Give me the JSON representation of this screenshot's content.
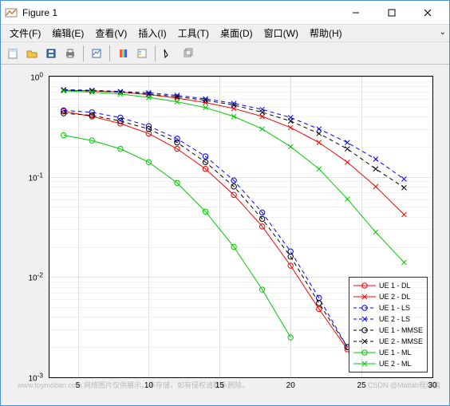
{
  "window": {
    "title": "Figure 1"
  },
  "menus": [
    "文件(F)",
    "编辑(E)",
    "查看(V)",
    "插入(I)",
    "工具(T)",
    "桌面(D)",
    "窗口(W)",
    "帮助(H)"
  ],
  "toolbar_icons": [
    "new-figure",
    "open",
    "save",
    "print",
    "sep",
    "zoom-in",
    "sep",
    "colorbar",
    "legend",
    "sep",
    "arrow",
    "rotate3d"
  ],
  "chart_data": {
    "type": "line",
    "xlabel": "",
    "ylabel": "",
    "xlim": [
      3,
      30
    ],
    "ylim": [
      0.001,
      1
    ],
    "yscale": "log",
    "xticks": [
      5,
      10,
      15,
      20,
      25,
      30
    ],
    "yticks_exp": [
      -3,
      -2,
      -1,
      0
    ],
    "x": [
      4,
      6,
      8,
      10,
      12,
      14,
      16,
      18,
      20,
      22,
      24,
      26,
      28
    ],
    "series": [
      {
        "name": "UE 1 - DL",
        "color": "#ff0000",
        "marker": "o",
        "dash": false,
        "values": [
          0.45,
          0.4,
          0.34,
          0.27,
          0.19,
          0.12,
          0.066,
          0.032,
          0.013,
          0.0048,
          0.0019,
          null,
          null
        ]
      },
      {
        "name": "UE 2 - DL",
        "color": "#ff0000",
        "marker": "x",
        "dash": false,
        "values": [
          0.73,
          0.72,
          0.7,
          0.66,
          0.61,
          0.55,
          0.48,
          0.4,
          0.31,
          0.22,
          0.14,
          0.08,
          0.042
        ]
      },
      {
        "name": "UE 1 - LS",
        "color": "#0000ff",
        "marker": "o",
        "dash": true,
        "values": [
          0.46,
          0.44,
          0.39,
          0.32,
          0.24,
          0.16,
          0.092,
          0.044,
          0.018,
          0.0062,
          0.002,
          0.00099,
          null
        ]
      },
      {
        "name": "UE 2 - LS",
        "color": "#0000ff",
        "marker": "x",
        "dash": true,
        "values": [
          0.74,
          0.73,
          0.71,
          0.69,
          0.65,
          0.6,
          0.54,
          0.47,
          0.39,
          0.3,
          0.22,
          0.15,
          0.095
        ]
      },
      {
        "name": "UE 1 - MMSE",
        "color": "#000000",
        "marker": "o",
        "dash": true,
        "values": [
          0.43,
          0.41,
          0.36,
          0.3,
          0.22,
          0.14,
          0.08,
          0.038,
          0.016,
          0.0055,
          0.002,
          null,
          null
        ]
      },
      {
        "name": "UE 2 - MMSE",
        "color": "#000000",
        "marker": "x",
        "dash": true,
        "values": [
          0.73,
          0.72,
          0.7,
          0.67,
          0.63,
          0.58,
          0.52,
          0.44,
          0.36,
          0.27,
          0.19,
          0.12,
          0.078
        ]
      },
      {
        "name": "UE 1 - ML",
        "color": "#00cc00",
        "marker": "o",
        "dash": false,
        "values": [
          0.26,
          0.23,
          0.19,
          0.14,
          0.087,
          0.045,
          0.02,
          0.0075,
          0.0025,
          null,
          null,
          null,
          null
        ]
      },
      {
        "name": "UE 2 - ML",
        "color": "#00cc00",
        "marker": "x",
        "dash": false,
        "values": [
          0.72,
          0.7,
          0.67,
          0.62,
          0.56,
          0.49,
          0.4,
          0.3,
          0.2,
          0.12,
          0.06,
          0.028,
          0.014
        ]
      }
    ],
    "legend_pos": "southeast"
  },
  "watermark": {
    "left": "www.toymoban.com 网络图片仅供展示，非存储，如有侵权请联系删除。",
    "right": "CSDN @Matlab程序猿"
  }
}
